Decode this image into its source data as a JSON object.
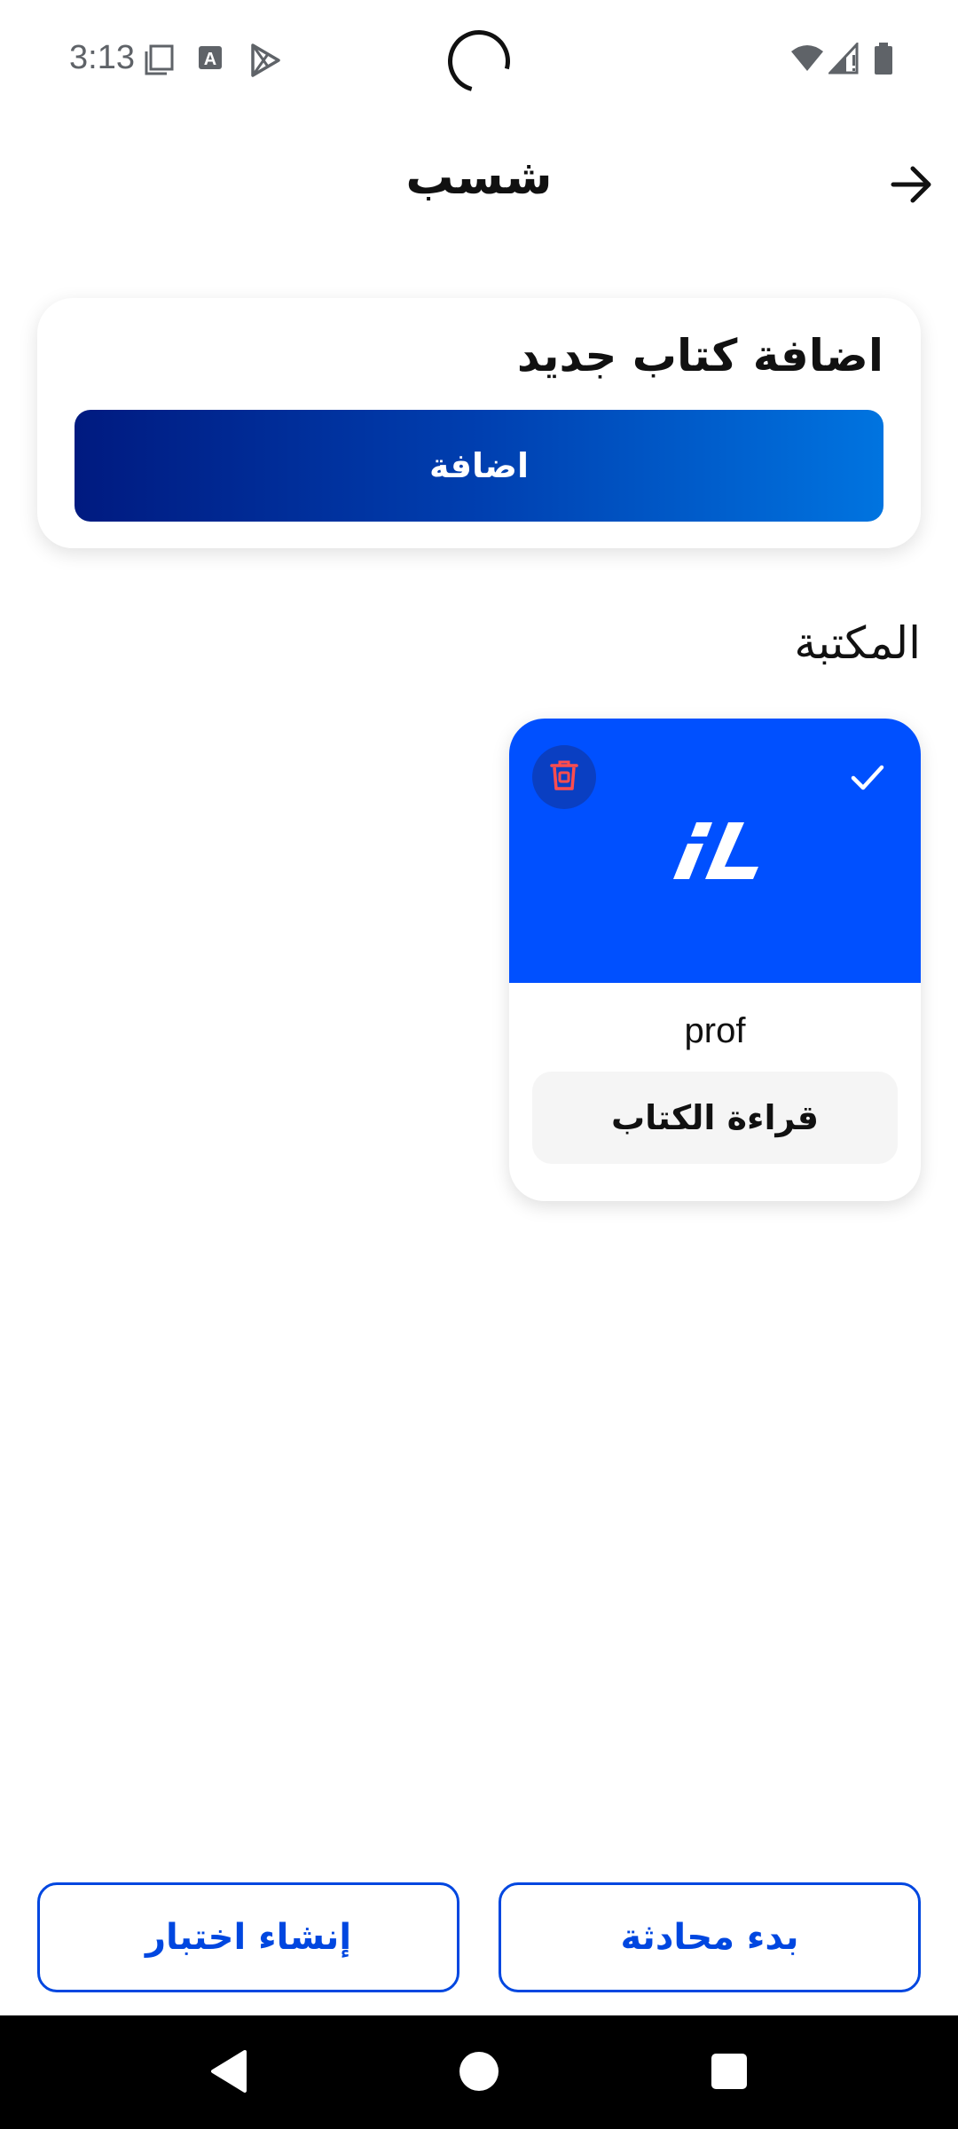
{
  "status_bar": {
    "time": "3:13",
    "icons": [
      "notification-copy-icon",
      "font-a-icon",
      "play-store-icon",
      "wifi-icon",
      "signal-icon",
      "battery-icon"
    ]
  },
  "header": {
    "title": "شسب",
    "back_icon": "arrow-right-icon"
  },
  "add_card": {
    "title": "اضافة كتاب جديد",
    "button_label": "اضافة"
  },
  "library": {
    "label": "المكتبة",
    "books": [
      {
        "name": "prof",
        "read_label": "قراءة الكتاب",
        "cover_color": "#0050ff",
        "selected": true
      }
    ]
  },
  "bottom_actions": {
    "create_quiz_label": "إنشاء اختبار",
    "start_chat_label": "بدء محادثة"
  },
  "nav_bar": {
    "icons": [
      "back-triangle-icon",
      "home-circle-icon",
      "recents-square-icon"
    ]
  },
  "colors": {
    "accent": "#0047e0",
    "gradient_start": "#001a80",
    "gradient_end": "#0074e0",
    "delete_red": "#ff4d4d"
  }
}
